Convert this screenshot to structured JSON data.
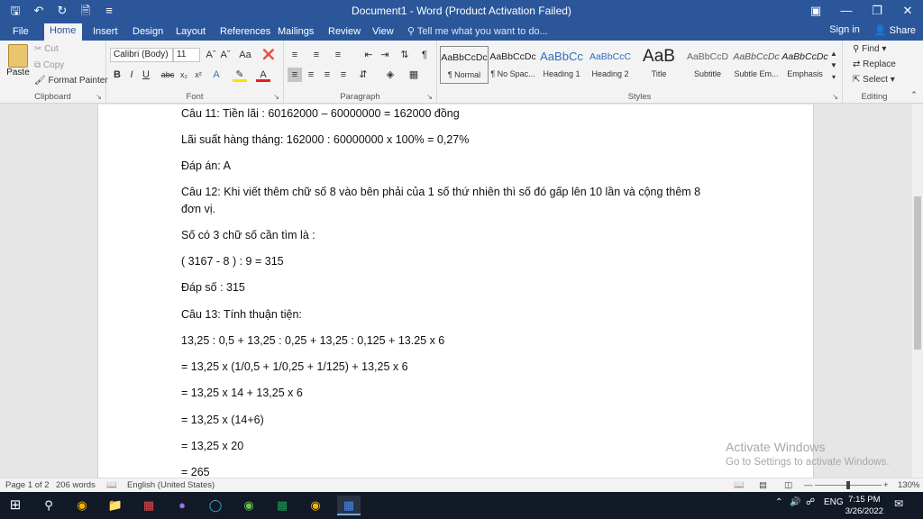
{
  "titlebar": {
    "title": "Document1 - Word (Product Activation Failed)",
    "qat": [
      "save-icon",
      "undo-icon",
      "redo-icon",
      "new-doc-icon",
      "customize-icon"
    ],
    "controls": [
      "ribbon-display-icon",
      "minimize-icon",
      "maximize-icon",
      "close-icon"
    ]
  },
  "tabs": [
    "File",
    "Home",
    "Insert",
    "Design",
    "Layout",
    "References",
    "Mailings",
    "Review",
    "View"
  ],
  "tellme": "Tell me what you want to do...",
  "account": {
    "signin": "Sign in",
    "share": "Share"
  },
  "clipboard": {
    "paste": "Paste",
    "cut": "Cut",
    "copy": "Copy",
    "format_painter": "Format Painter",
    "label": "Clipboard"
  },
  "font": {
    "name": "Calibri (Body)",
    "size": "11",
    "label": "Font"
  },
  "paragraph": {
    "label": "Paragraph"
  },
  "styles": {
    "label": "Styles",
    "items": [
      {
        "preview": "AaBbCcDc",
        "name": "¶ Normal"
      },
      {
        "preview": "AaBbCcDc",
        "name": "¶ No Spac..."
      },
      {
        "preview": "AaBbCc",
        "name": "Heading 1"
      },
      {
        "preview": "AaBbCcC",
        "name": "Heading 2"
      },
      {
        "preview": "AaB",
        "name": "Title"
      },
      {
        "preview": "AaBbCcD",
        "name": "Subtitle"
      },
      {
        "preview": "AaBbCcDc",
        "name": "Subtle Em..."
      },
      {
        "preview": "AaBbCcDc",
        "name": "Emphasis"
      }
    ]
  },
  "editing": {
    "find": "Find",
    "replace": "Replace",
    "select": "Select",
    "label": "Editing"
  },
  "document": {
    "lines": [
      "Câu 11: Tiền lãi : 60162000 – 60000000 = 162000 đồng",
      "Lãi suất hàng tháng: 162000 : 60000000 x 100%  = 0,27%",
      "Đáp án: A",
      "Câu 12: Khi viết thêm chữ số 8 vào bên phải của 1 số thứ nhiên thì số đó gấp lên 10 lần và cộng thêm 8 đơn vị.",
      "Số có 3 chữ số cần tìm là :",
      "( 3167 - 8 ) : 9 = 315",
      "Đáp số : 315",
      "Câu 13: Tính thuận tiện:",
      "13,25 : 0,5 + 13,25 : 0,25 + 13,25 : 0,125 + 13.25 x 6",
      "= 13,25 x (1/0,5 + 1/0,25 + 1/125) + 13,25 x 6",
      "= 13,25 x 14 + 13,25 x 6",
      "= 13,25 x (14+6)",
      "= 13,25 x 20",
      "= 265"
    ]
  },
  "watermark": {
    "line1": "Activate Windows",
    "line2": "Go to Settings to activate Windows."
  },
  "status": {
    "page": "Page 1 of 2",
    "words": "206 words",
    "language": "English (United States)",
    "zoom": "130%"
  },
  "taskbar": {
    "time": "7:15 PM",
    "date": "3/26/2022",
    "lang": "ENG"
  }
}
